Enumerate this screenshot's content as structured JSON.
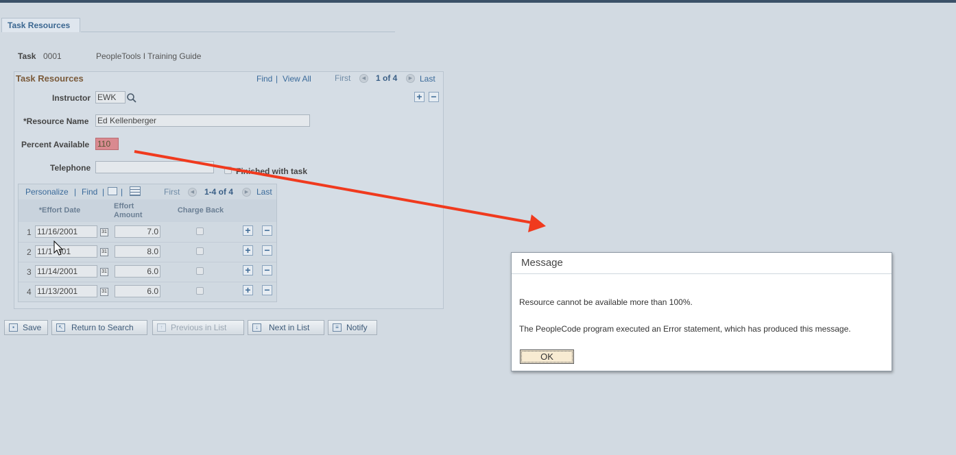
{
  "page_tab": "Task Resources",
  "task": {
    "label": "Task",
    "number": "0001",
    "description": "PeopleTools I Training Guide"
  },
  "resources_box": {
    "title": "Task Resources",
    "find": "Find",
    "sep": "|",
    "view_all": "View All",
    "first": "First",
    "counter": "1 of 4",
    "last": "Last"
  },
  "fields": {
    "instructor_label": "Instructor",
    "instructor_value": "EWK",
    "resource_name_label": "*Resource Name",
    "resource_name_value": "Ed Kellenberger",
    "percent_label": "Percent Available",
    "percent_value": "110",
    "telephone_label": "Telephone",
    "telephone_value": "",
    "finished_label": "Finished with task"
  },
  "grid": {
    "personalize": "Personalize",
    "sep": "|",
    "find": "Find",
    "first": "First",
    "counter": "1-4 of 4",
    "last": "Last",
    "headers": {
      "effort_date": "*Effort Date",
      "effort_amount_1": "Effort",
      "effort_amount_2": "Amount",
      "charge_back": "Charge Back"
    },
    "rows": [
      {
        "num": "1",
        "date": "11/16/2001",
        "amount": "7.0"
      },
      {
        "num": "2",
        "date": "11/1  001",
        "amount": "8.0"
      },
      {
        "num": "3",
        "date": "11/14/2001",
        "amount": "6.0"
      },
      {
        "num": "4",
        "date": "11/13/2001",
        "amount": "6.0"
      }
    ]
  },
  "toolbar": {
    "save": "Save",
    "return_to_search": "Return to Search",
    "previous_in_list": "Previous in List",
    "next_in_list": "Next in List",
    "notify": "Notify"
  },
  "dialog": {
    "title": "Message",
    "line1": "Resource cannot be available more than 100%.",
    "line2": "The PeopleCode program executed an Error statement, which has produced this message.",
    "ok": "OK"
  },
  "colors": {
    "accent": "#3a6a9a",
    "error_field": "#d98a90",
    "annotation_arrow": "#f03a1e"
  },
  "icons": [
    "search-icon",
    "calendar-icon",
    "add-row-icon",
    "delete-row-icon",
    "save-icon",
    "notify-icon",
    "mouse-cursor-icon",
    "annotation-arrow"
  ]
}
